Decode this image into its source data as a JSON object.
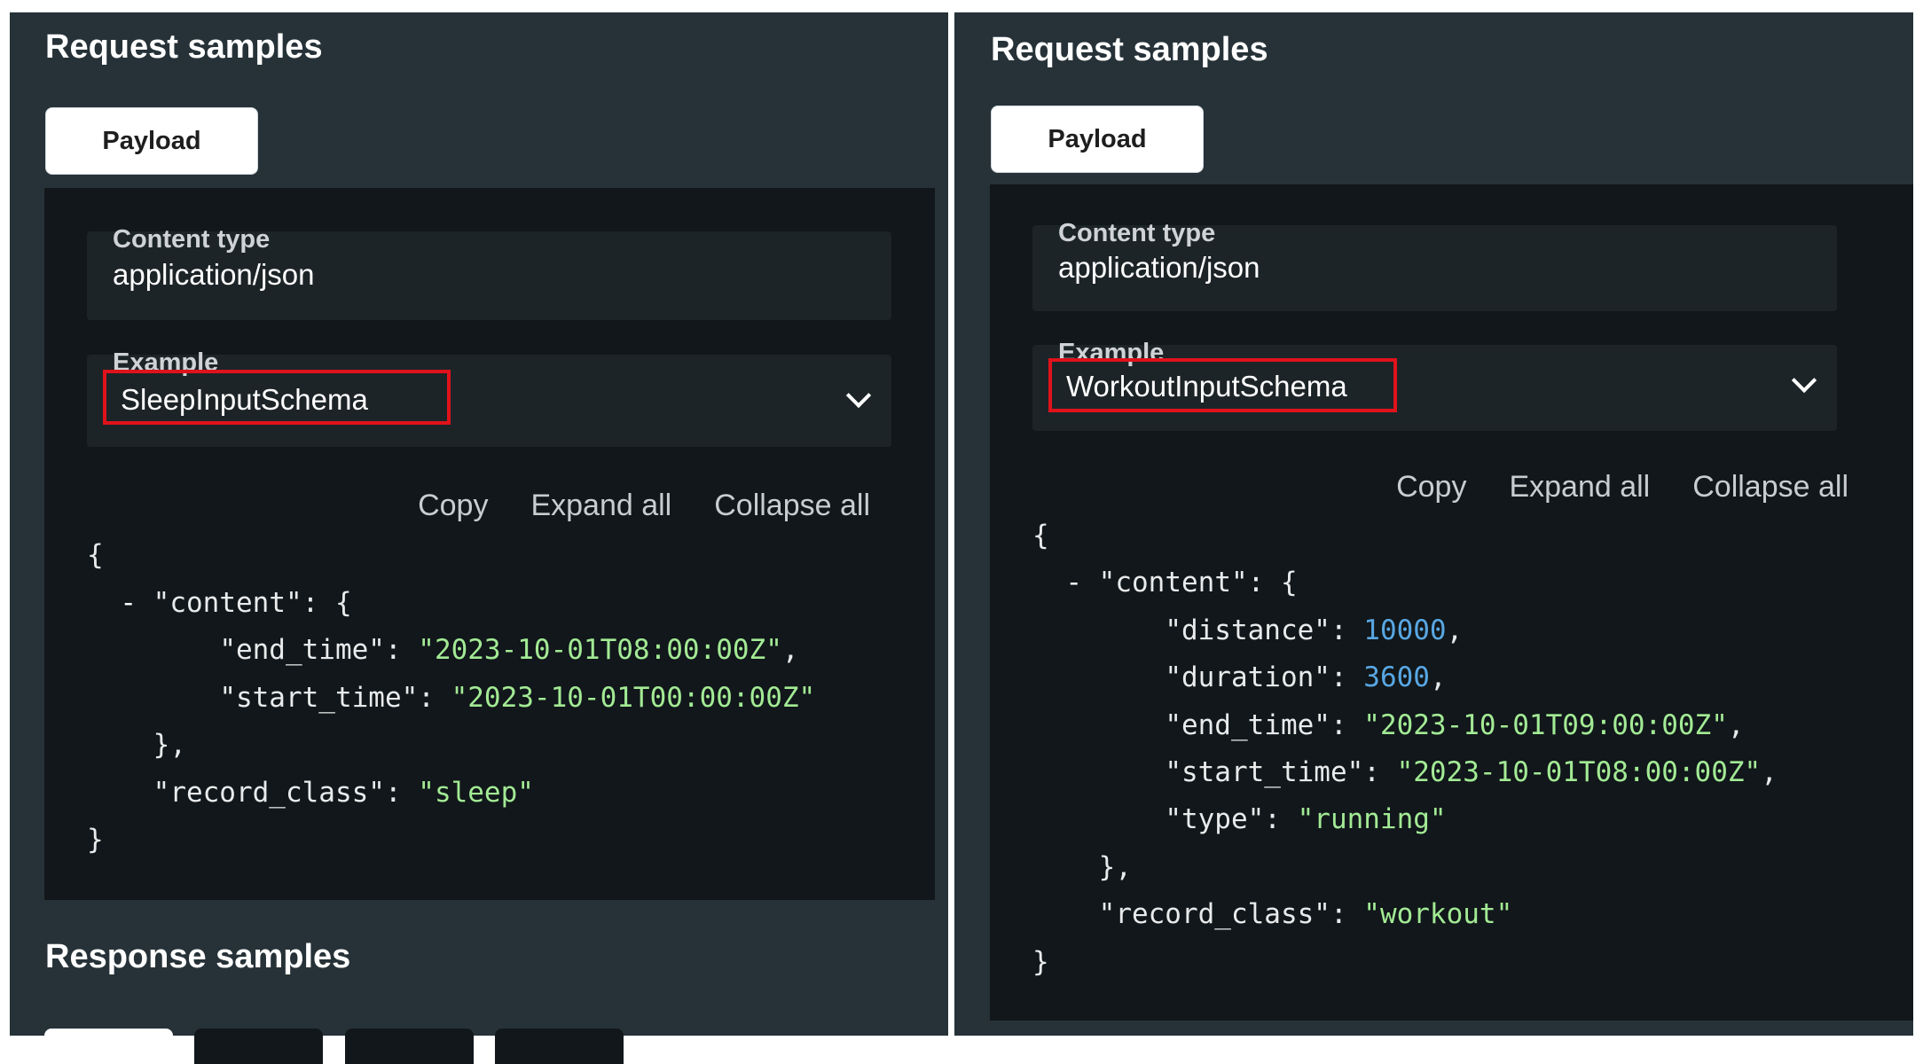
{
  "left": {
    "request_title": "Request samples",
    "payload_tab": "Payload",
    "content_type_label": "Content type",
    "content_type_value": "application/json",
    "example_label": "Example",
    "example_value": "SleepInputSchema",
    "actions": {
      "copy": "Copy",
      "expand_all": "Expand all",
      "collapse_all": "Collapse all"
    },
    "json": {
      "open_brace": "{",
      "collapse_toggle": "-",
      "content_key": "\"content\": {",
      "end_time_key": "\"end_time\": ",
      "end_time_value": "\"2023-10-01T08:00:00Z\"",
      "start_time_key": "\"start_time\": ",
      "start_time_value": "\"2023-10-01T00:00:00Z\"",
      "content_close": "},",
      "record_class_key": "\"record_class\": ",
      "record_class_value": "\"sleep\"",
      "close_brace": "}"
    },
    "response_title": "Response samples"
  },
  "right": {
    "request_title": "Request samples",
    "payload_tab": "Payload",
    "content_type_label": "Content type",
    "content_type_value": "application/json",
    "example_label": "Example",
    "example_value": "WorkoutInputSchema",
    "actions": {
      "copy": "Copy",
      "expand_all": "Expand all",
      "collapse_all": "Collapse all"
    },
    "json": {
      "open_brace": "{",
      "collapse_toggle": "-",
      "content_key": "\"content\": {",
      "distance_key": "\"distance\": ",
      "distance_value": "10000",
      "duration_key": "\"duration\": ",
      "duration_value": "3600",
      "end_time_key": "\"end_time\": ",
      "end_time_value": "\"2023-10-01T09:00:00Z\"",
      "start_time_key": "\"start_time\": ",
      "start_time_value": "\"2023-10-01T08:00:00Z\"",
      "type_key": "\"type\": ",
      "type_value": "\"running\"",
      "content_close": "},",
      "record_class_key": "\"record_class\": ",
      "record_class_value": "\"workout\"",
      "close_brace": "}"
    }
  },
  "colors": {
    "panel_bg": "#263238",
    "code_bg": "#11171a",
    "field_bg": "#1d2428",
    "string_green": "#a3ea95",
    "number_blue": "#59a7e3",
    "highlight_red": "#e0121b"
  },
  "icons": {
    "dropdown": "chevron-down-icon"
  }
}
